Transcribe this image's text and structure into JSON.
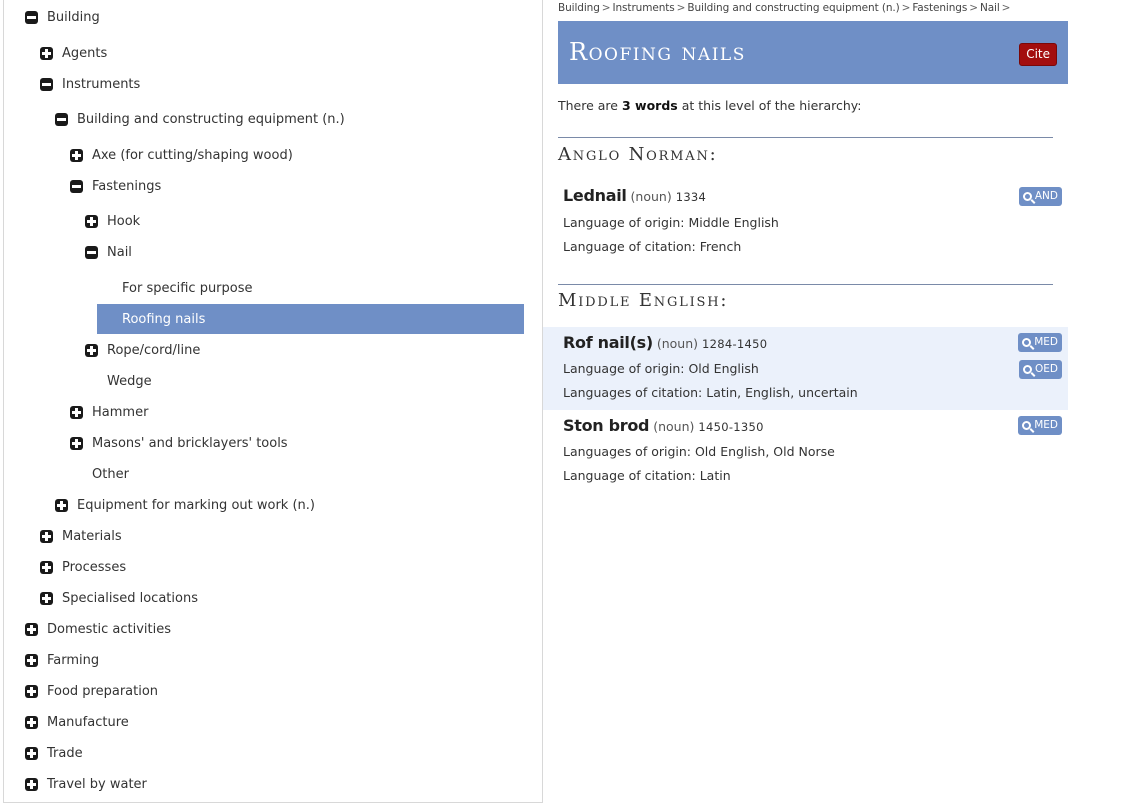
{
  "tree": {
    "building": "Building",
    "agents": "Agents",
    "instruments": "Instruments",
    "building_equipment": "Building and constructing equipment (n.)",
    "axe": "Axe (for cutting/shaping wood)",
    "fastenings": "Fastenings",
    "hook": "Hook",
    "nail": "Nail",
    "for_specific_purpose": "For specific purpose",
    "roofing_nails": "Roofing nails",
    "rope": "Rope/cord/line",
    "wedge": "Wedge",
    "hammer": "Hammer",
    "masons_tools": "Masons' and bricklayers' tools",
    "other": "Other",
    "marking_equipment": "Equipment for marking out work (n.)",
    "materials": "Materials",
    "processes": "Processes",
    "specialised_locations": "Specialised locations",
    "domestic_activities": "Domestic activities",
    "farming": "Farming",
    "food_preparation": "Food preparation",
    "manufacture": "Manufacture",
    "trade": "Trade",
    "travel_by_water": "Travel by water"
  },
  "breadcrumb": {
    "items": [
      "Building",
      "Instruments",
      "Building and constructing equipment (n.)",
      "Fastenings",
      "Nail"
    ],
    "separator": ">"
  },
  "header": {
    "title": "Roofing nails",
    "cite_label": "Cite"
  },
  "summary": {
    "prefix": "There are ",
    "count": "3 words",
    "suffix": " at this level of the hierarchy:"
  },
  "sections": {
    "anglo_norman": {
      "heading": "Anglo Norman:",
      "entries": [
        {
          "headword": "Lednail",
          "pos": "(noun)",
          "dates": "1334",
          "origin": "Language of origin: Middle English",
          "citation": "Language of citation: French",
          "buttons": [
            "AND"
          ]
        }
      ]
    },
    "middle_english": {
      "heading": "Middle English:",
      "entries": [
        {
          "headword": "Rof nail(s)",
          "pos": "(noun)",
          "dates": "1284-1450",
          "origin": "Language of origin: Old English",
          "citation": "Languages of citation: Latin, English, uncertain",
          "buttons": [
            "MED",
            "OED"
          ]
        },
        {
          "headword": "Ston brod",
          "pos": "(noun)",
          "dates": "1450-1350",
          "origin": "Languages of origin: Old English, Old Norse",
          "citation": "Language of citation: Latin",
          "buttons": [
            "MED"
          ]
        }
      ]
    }
  },
  "colors": {
    "accent_blue": "#6f8fc6",
    "cite_red": "#a30e0e",
    "highlight_row": "#ebf1fb"
  },
  "icons": {
    "toggle_expanded": "minus-square-icon",
    "toggle_collapsed": "plus-square-icon",
    "dictionary_button": "search-icon"
  }
}
